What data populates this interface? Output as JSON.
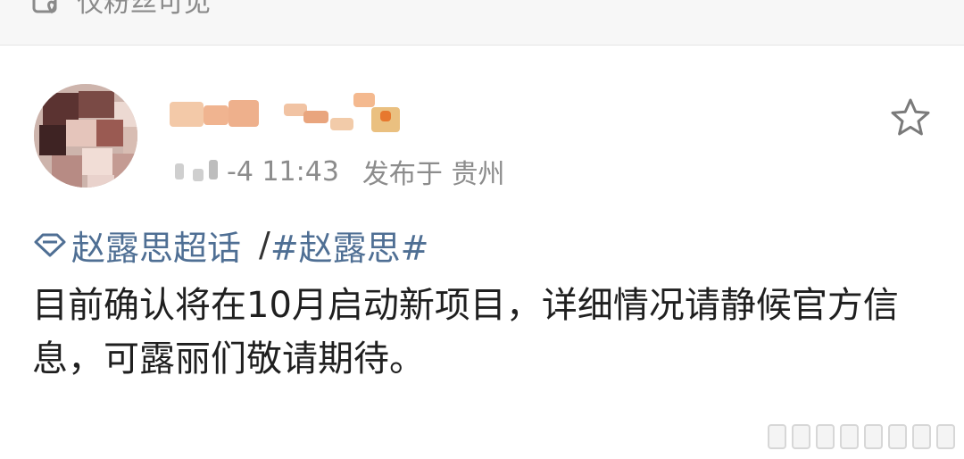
{
  "top_bar": {
    "visibility_label": "仅粉丝可见",
    "lock_icon": "lock-heart-icon"
  },
  "post": {
    "timestamp": "-4 11:43",
    "published_in": "发布于 贵州",
    "favorite_icon": "star-outline-icon",
    "super_topic": "赵露思超话",
    "separator": "/",
    "hashtag": "#赵露思#",
    "body": "目前确认将在10月启动新项目，详细情况请静候官方信息，可露丽们敬请期待。"
  },
  "colors": {
    "link": "#4f6f94",
    "meta": "#8c8c8c",
    "text": "#1f1f1f"
  }
}
